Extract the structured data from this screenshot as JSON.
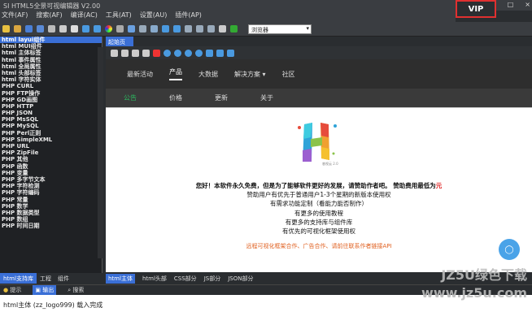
{
  "window": {
    "title": "SI HTML5全景可视编辑器 V2.00",
    "minimize": "–",
    "maximize": "□",
    "close": "×"
  },
  "vip": "VIP",
  "menu": [
    "文件(AF)",
    "搜索(AF)",
    "编译(AC)",
    "工具(AT)",
    "设置(AU)",
    "插件(AP)"
  ],
  "browser_select": "浏览器",
  "tree_items": [
    "html layui组件",
    "html MUI组件",
    "html 主体标签",
    "html 事件属性",
    "html 全局属性",
    "html 头部标签",
    "html 字符实体",
    "PHP CURL",
    "PHP FTP操作",
    "PHP GD画图",
    "PHP HTTP",
    "PHP JSON",
    "PHP MsSQL",
    "PHP MySQL",
    "PHP Perl正则",
    "PHP SimpleXML",
    "PHP URL",
    "PHP ZipFile",
    "PHP 其他",
    "PHP 函数",
    "PHP 变量",
    "PHP 多字节文本",
    "PHP 字符检测",
    "PHP 字符编码",
    "PHP 常量",
    "PHP 数学",
    "PHP 数据类型",
    "PHP 数组",
    "PHP 时间日期"
  ],
  "left_tabs": [
    "html支持库",
    "工程",
    "组件"
  ],
  "doc_tab": "起始页",
  "site_nav": [
    "最新活动",
    "产品",
    "大数据",
    "解决方案 ▾",
    "社区"
  ],
  "sub_nav": [
    "公告",
    "价格",
    "更新",
    "关于"
  ],
  "logo_caption": "睿视云 2.0",
  "notice": {
    "line1a": "您好！本软件永久免费，但是为了能够软件更好的发展，请赞助作者吧。 赞助费用最低为",
    "line1b": "元",
    "lines": [
      "赞助用户有优先于普通用户1-3个星期的新版本使用权",
      "有需求功能定制（看能力能否制作）",
      "有更多的使用教程",
      "有更多的支持库与组件库",
      "有优先的可视化框架使用权"
    ],
    "orange": "远程可视化框架合作、广告合作、请前往联系作者链接API"
  },
  "bottom_tabs": [
    "html主体",
    "html头部",
    "CSS部分",
    "JS部分",
    "JSON部分"
  ],
  "output_tabs": [
    "提示",
    "输出",
    "搜索"
  ],
  "status": "html主体 (zz_logo999) 载入完成",
  "watermark": {
    "line1": "JZ5U绿色下载",
    "line2": "www.jz5u.com"
  }
}
